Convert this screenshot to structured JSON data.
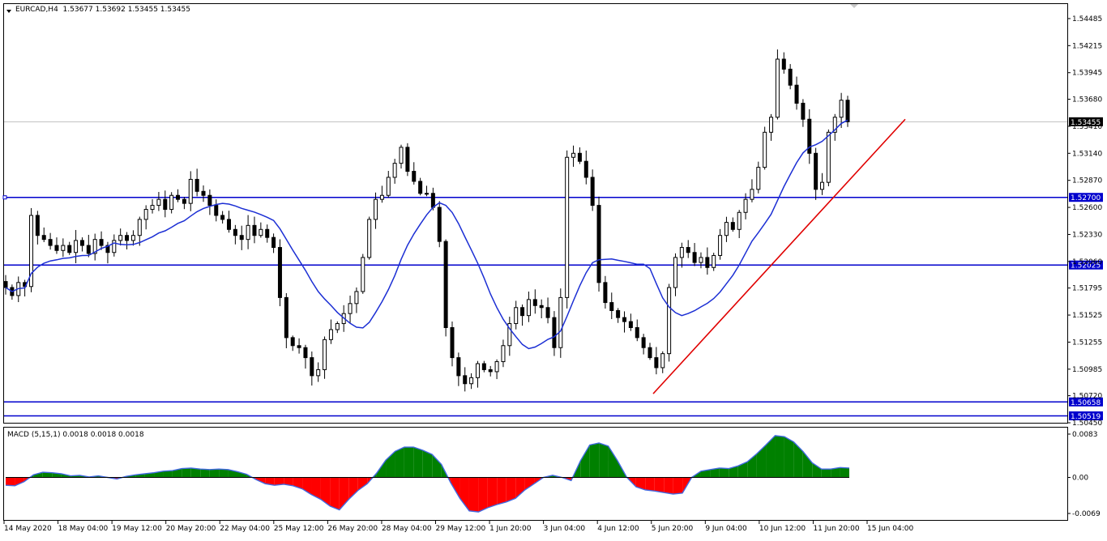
{
  "header": {
    "symbol_tf": "EURCAD,H4",
    "ohlc": "1.53677 1.53692 1.53455 1.53455"
  },
  "colors": {
    "background": "#ffffff",
    "grid": "#c0c0c0",
    "candle": "#000000",
    "ma": "#1c2fd4",
    "level_line": "#0000cd",
    "trendline": "#e00000",
    "macd_pos": "#008000",
    "macd_neg": "#ff0000",
    "macd_signal": "#4169e1"
  },
  "chart_data": [
    {
      "type": "candlestick",
      "symbol": "EURCAD",
      "timeframe": "H4",
      "ylim": [
        1.5045,
        1.5463
      ],
      "y_ticks": [
        "1.54485",
        "1.54215",
        "1.53945",
        "1.53680",
        "1.53410",
        "1.53140",
        "1.52870",
        "1.52600",
        "1.52330",
        "1.52060",
        "1.51795",
        "1.51525",
        "1.51255",
        "1.50985",
        "1.50720",
        "1.50450"
      ],
      "x_ticks": [
        "14 May 2020",
        "18 May 04:00",
        "19 May 12:00",
        "20 May 20:00",
        "22 May 04:00",
        "25 May 12:00",
        "26 May 20:00",
        "28 May 04:00",
        "29 May 12:00",
        "1 Jun 20:00",
        "3 Jun 04:00",
        "4 Jun 12:00",
        "5 Jun 20:00",
        "9 Jun 04:00",
        "10 Jun 12:00",
        "11 Jun 20:00",
        "15 Jun 04:00"
      ],
      "last_price": "1.53455",
      "horizontal_levels": [
        "1.52700",
        "1.52025",
        "1.50658",
        "1.50519"
      ],
      "trendline": [
        [
          1.5074,
          1.5348
        ]
      ],
      "close_path": [
        1.518,
        1.5172,
        1.5185,
        1.5181,
        1.5252,
        1.5232,
        1.5228,
        1.5222,
        1.5217,
        1.5222,
        1.5215,
        1.5227,
        1.5222,
        1.5214,
        1.5228,
        1.5222,
        1.5215,
        1.5227,
        1.5232,
        1.5227,
        1.5232,
        1.5248,
        1.5258,
        1.5262,
        1.5268,
        1.5258,
        1.5272,
        1.5268,
        1.5264,
        1.5288,
        1.5276,
        1.5272,
        1.5262,
        1.5252,
        1.5248,
        1.5238,
        1.5232,
        1.5228,
        1.5242,
        1.5232,
        1.5238,
        1.523,
        1.522,
        1.517,
        1.513,
        1.5122,
        1.512,
        1.511,
        1.5092,
        1.5098,
        1.5128,
        1.5138,
        1.5144,
        1.5154,
        1.5164,
        1.5176,
        1.521,
        1.5248,
        1.5268,
        1.5272,
        1.529,
        1.5304,
        1.532,
        1.5296,
        1.5286,
        1.5274,
        1.5274,
        1.526,
        1.5226,
        1.514,
        1.511,
        1.5092,
        1.5084,
        1.509,
        1.5104,
        1.5098,
        1.5096,
        1.5106,
        1.5122,
        1.5144,
        1.516,
        1.5152,
        1.5168,
        1.5162,
        1.516,
        1.515,
        1.512,
        1.517,
        1.531,
        1.5314,
        1.5306,
        1.529,
        1.5262,
        1.5185,
        1.5165,
        1.5157,
        1.515,
        1.5146,
        1.514,
        1.513,
        1.512,
        1.511,
        1.51,
        1.5114,
        1.518,
        1.521,
        1.522,
        1.5215,
        1.5205,
        1.521,
        1.52,
        1.5212,
        1.5232,
        1.5245,
        1.5238,
        1.5255,
        1.5268,
        1.5278,
        1.53,
        1.5335,
        1.535,
        1.5408,
        1.5398,
        1.5382,
        1.5364,
        1.5348,
        1.5314,
        1.5278,
        1.5285,
        1.5335,
        1.535,
        1.5367,
        1.53455
      ]
    },
    {
      "type": "area",
      "title": "MACD (5,15,1) 0.0018 0.0018 0.0018",
      "ylim": [
        -0.0069,
        0.0083
      ],
      "y_ticks": [
        "0.0083",
        "0.00",
        "-0.0069"
      ],
      "series": [
        {
          "values": [
            -0.0015,
            -0.0016,
            -0.0008,
            0.0005,
            0.001,
            0.0009,
            0.0007,
            0.0003,
            0.0004,
            0.0001,
            0.0003,
            0.0,
            -0.0003,
            0.0002,
            0.0005,
            0.0007,
            0.0009,
            0.0012,
            0.0013,
            0.0017,
            0.0018,
            0.0016,
            0.0015,
            0.0016,
            0.0015,
            0.0011,
            0.0006,
            -0.0004,
            -0.0012,
            -0.0015,
            -0.0013,
            -0.0016,
            -0.0022,
            -0.0033,
            -0.0042,
            -0.0055,
            -0.0062,
            -0.0042,
            -0.0025,
            -0.0012,
            0.0008,
            0.0033,
            0.005,
            0.0058,
            0.0058,
            0.0052,
            0.0044,
            0.0025,
            -0.001,
            -0.004,
            -0.0064,
            -0.0066,
            -0.0058,
            -0.0052,
            -0.0047,
            -0.004,
            -0.0024,
            -0.0012,
            0.0,
            0.0004,
            0.0,
            -0.0006,
            0.0032,
            0.0062,
            0.0066,
            0.006,
            0.0032,
            0.0,
            -0.0018,
            -0.0024,
            -0.0026,
            -0.0029,
            -0.0032,
            -0.003,
            0.0,
            0.0012,
            0.0015,
            0.0018,
            0.0017,
            0.0022,
            0.003,
            0.0045,
            0.0062,
            0.008,
            0.0078,
            0.0068,
            0.005,
            0.0028,
            0.0016,
            0.0016,
            0.0019,
            0.0018
          ]
        }
      ]
    }
  ]
}
